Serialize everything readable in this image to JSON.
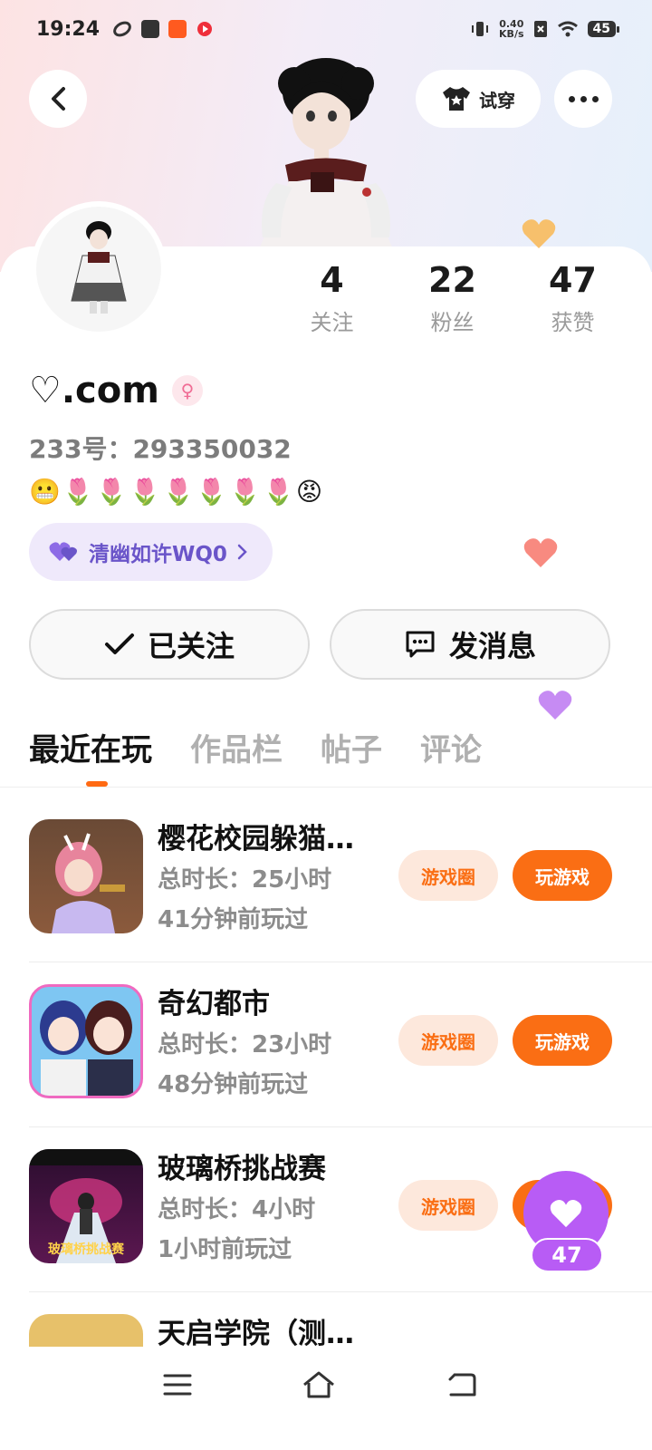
{
  "status_bar": {
    "time": "19:24",
    "net_speed_value": "0.40",
    "net_speed_unit": "KB/s",
    "battery": "45"
  },
  "header": {
    "try_on_label": "试穿"
  },
  "stats": [
    {
      "value": "4",
      "label": "关注"
    },
    {
      "value": "22",
      "label": "粉丝"
    },
    {
      "value": "47",
      "label": "获赞"
    }
  ],
  "profile": {
    "username": "♡.com",
    "uid": "233号：293350032",
    "bio": "😬🌷🌷🌷🌷🌷🌷🌷😡",
    "group_name": "清幽如许WQ0"
  },
  "actions": {
    "followed_label": "已关注",
    "message_label": "发消息"
  },
  "tabs": [
    "最近在玩",
    "作品栏",
    "帖子",
    "评论"
  ],
  "games": [
    {
      "title": "樱花校园躲猫…",
      "duration": "总时长：25小时",
      "last_played": "41分钟前玩过",
      "circle_label": "游戏圈",
      "play_label": "玩游戏"
    },
    {
      "title": "奇幻都市",
      "duration": "总时长：23小时",
      "last_played": "48分钟前玩过",
      "circle_label": "游戏圈",
      "play_label": "玩游戏"
    },
    {
      "title": "玻璃桥挑战赛",
      "duration": "总时长：4小时",
      "last_played": "1小时前玩过",
      "circle_label": "游戏圈",
      "play_label": "玩游戏"
    },
    {
      "title": "天启学院（测…",
      "duration": "",
      "last_played": "",
      "circle_label": "",
      "play_label": ""
    }
  ],
  "game3_thumb_text": "玻璃桥挑战赛",
  "like_fab": {
    "count": "47"
  },
  "colors": {
    "accent_orange": "#fa6e14",
    "like_purple": "#b85cf5",
    "group_chip_bg": "#efe9fb"
  }
}
